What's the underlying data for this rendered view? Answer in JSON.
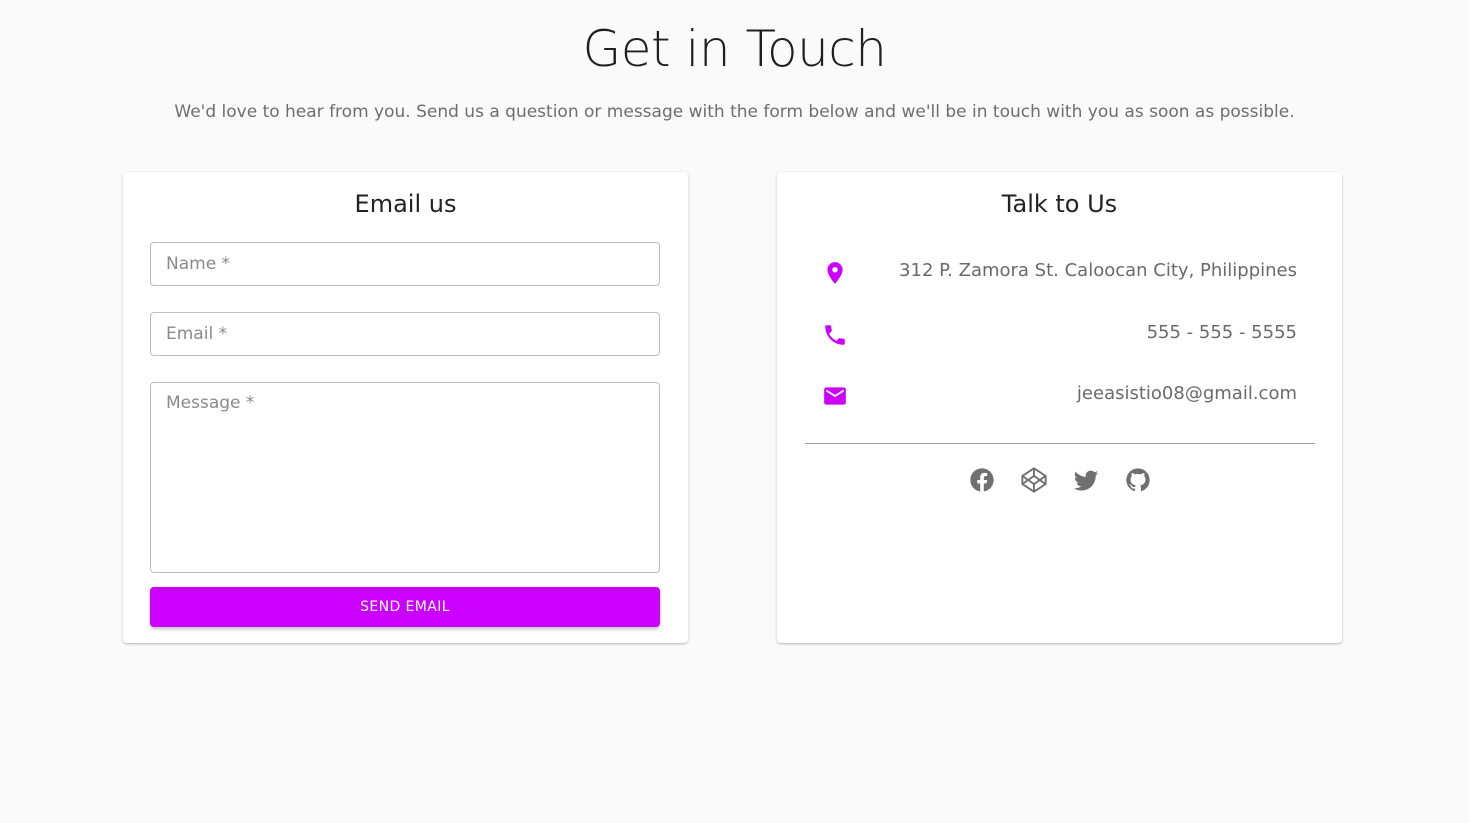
{
  "header": {
    "title": "Get in Touch",
    "subtitle": "We'd love to hear from you. Send us a question or message with the form below and we'll be in touch with you as soon as possible."
  },
  "email_card": {
    "title": "Email us",
    "name_placeholder": "Name *",
    "email_placeholder": "Email *",
    "message_placeholder": "Message *",
    "send_label": "SEND EMAIL"
  },
  "talk_card": {
    "title": "Talk to Us",
    "contacts": [
      {
        "icon": "location-pin-icon",
        "text": "312 P. Zamora St. Caloocan City, Philippines"
      },
      {
        "icon": "phone-icon",
        "text": "555 - 555 - 5555"
      },
      {
        "icon": "mail-icon",
        "text": "jeeasistio08@gmail.com"
      }
    ],
    "socials": [
      "facebook-icon",
      "codepen-icon",
      "twitter-icon",
      "github-icon"
    ]
  },
  "colors": {
    "accent": "#cc00ff",
    "background": "#fafafa",
    "card": "#ffffff",
    "muted_text": "#6e6e6e",
    "social_icon": "#707070"
  }
}
